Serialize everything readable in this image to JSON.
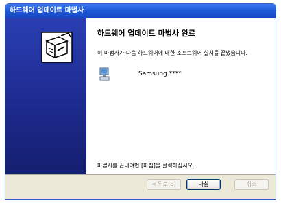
{
  "window": {
    "title": "하드웨어 업데이트 마법사"
  },
  "wizard": {
    "heading": "하드웨어 업데이트 마법사 완료",
    "description": "이 마법사가 다음 하드웨어에 대한 소프트웨어 설치를 끝냈습니다.",
    "device_name": "Samsung ****",
    "finish_note": "마법사를 끝내려면 [마침]을 클릭하십시오."
  },
  "buttons": {
    "back": "< 뒤로(B)",
    "finish": "마침",
    "cancel": "취소"
  },
  "icons": {
    "banner": "hardware-wizard-icon",
    "device": "monitor-icon"
  },
  "colors": {
    "title_bar": "#1f5ad8",
    "banner": "#1d2a8f",
    "dialog_face": "#ece9d8"
  }
}
